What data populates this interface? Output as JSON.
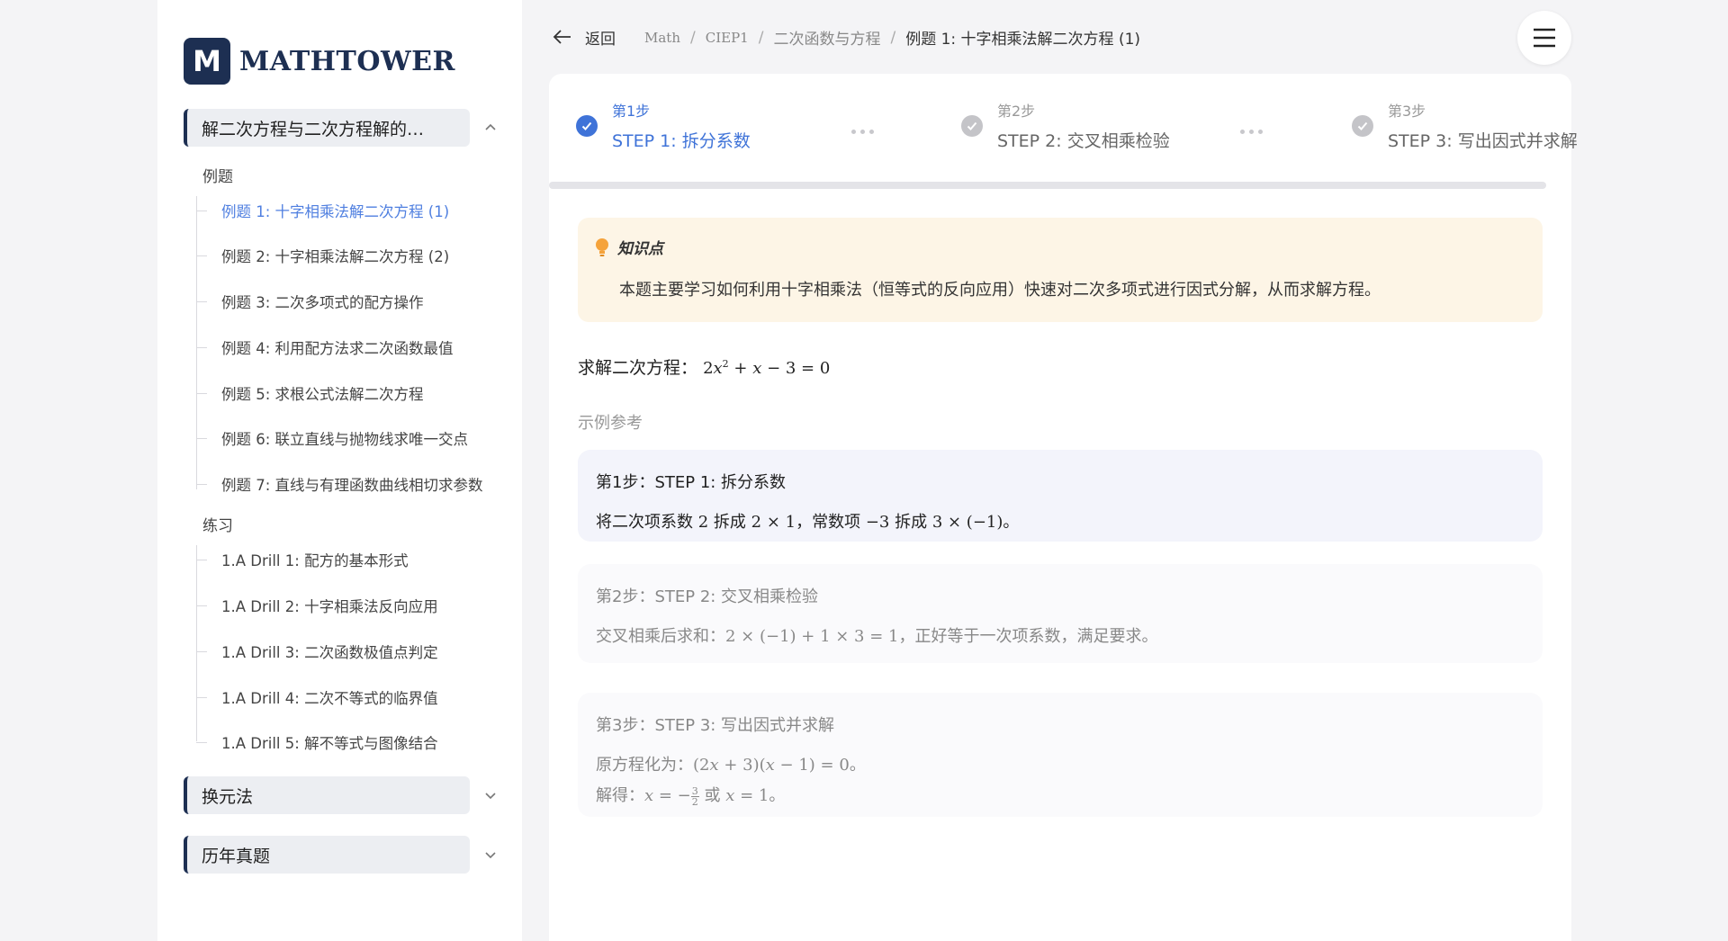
{
  "brand": {
    "logo_letter": "M",
    "name": "MATHTOWER",
    "color": "#1d2f52"
  },
  "sidebar": {
    "sections": [
      {
        "label": "解二次方程与二次方程解的…",
        "expanded": true
      },
      {
        "label": "换元法",
        "expanded": false
      },
      {
        "label": "历年真题",
        "expanded": false
      }
    ],
    "group_examples": "例题",
    "examples": [
      "例题 1: 十字相乘法解二次方程 (1)",
      "例题 2: 十字相乘法解二次方程 (2)",
      "例题 3: 二次多项式的配方操作",
      "例题 4: 利用配方法求二次函数最值",
      "例题 5: 求根公式法解二次方程",
      "例题 6: 联立直线与抛物线求唯一交点",
      "例题 7: 直线与有理函数曲线相切求参数"
    ],
    "group_drills": "练习",
    "drills": [
      "1.A Drill 1: 配方的基本形式",
      "1.A Drill 2: 十字相乘法反向应用",
      "1.A Drill 3: 二次函数极值点判定",
      "1.A Drill 4: 二次不等式的临界值",
      "1.A Drill 5: 解不等式与图像结合"
    ],
    "active_color": "#4f7fe0"
  },
  "topbar": {
    "back_label": "返回",
    "breadcrumb": [
      "Math",
      "CIEP1",
      "二次函数与方程",
      "例题 1: 十字相乘法解二次方程 (1)"
    ],
    "menu_icon": "hamburger-icon"
  },
  "steps": [
    {
      "small": "第1步",
      "big": "STEP 1: 拆分系数",
      "state": "active"
    },
    {
      "small": "第2步",
      "big": "STEP 2: 交叉相乘检验",
      "state": "done"
    },
    {
      "small": "第3步",
      "big": "STEP 3: 写出因式并求解",
      "state": "done"
    }
  ],
  "knowledge": {
    "icon": "lightbulb-icon",
    "title": "知识点",
    "text": "本题主要学习如何利用十字相乘法（恒等式的反向应用）快速对二次多项式进行因式分解，从而求解方程。",
    "bg": "#fdf5e6"
  },
  "question": {
    "prefix": "求解二次方程："
  },
  "reference_label": "示例参考",
  "solution": {
    "step1": {
      "title": "第1步：STEP 1: 拆分系数",
      "t1": "将二次项系数 ",
      "t2": " 拆成 ",
      "t3": "，常数项 ",
      "t4": " 拆成 ",
      "t5": "。"
    },
    "step2": {
      "title": "第2步：STEP 2: 交叉相乘检验",
      "t1": "交叉相乘后求和：",
      "t2": "，正好等于一次项系数，满足要求。"
    },
    "step3": {
      "title": "第3步：STEP 3: 写出因式并求解",
      "l1": "原方程化为：",
      "l2": "解得：",
      "or": " 或 ",
      "end": "。"
    }
  }
}
